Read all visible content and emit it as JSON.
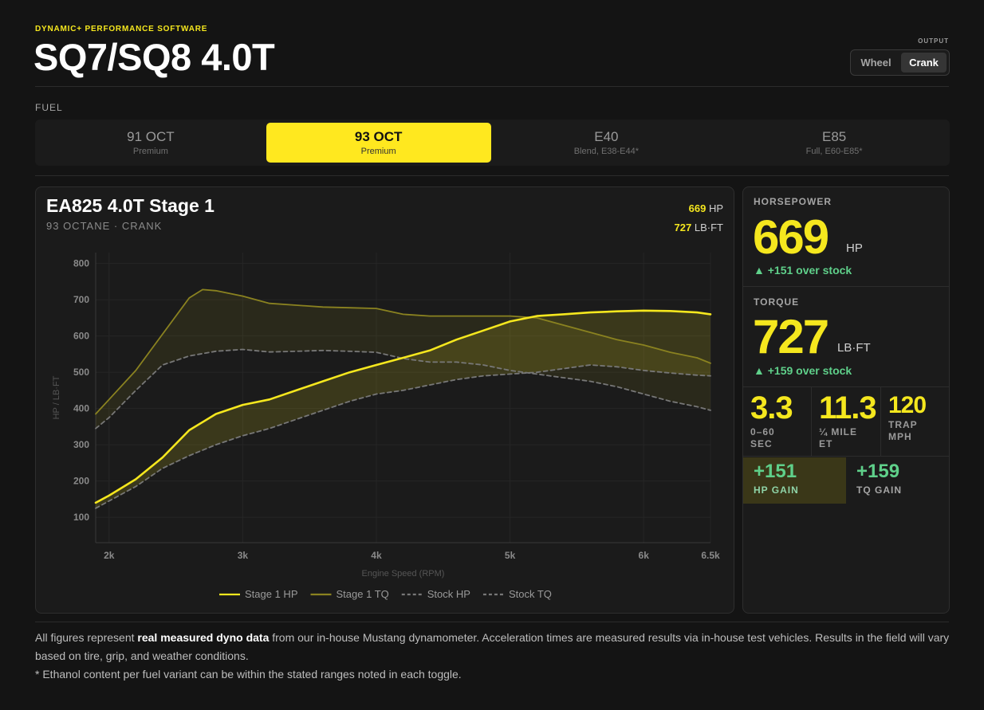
{
  "header": {
    "eyebrow": "DYNAMIC+ PERFORMANCE SOFTWARE",
    "title": "SQ7/SQ8 4.0T",
    "output_label": "OUTPUT",
    "output_options": [
      "Wheel",
      "Crank"
    ],
    "output_selected": "Crank"
  },
  "fuel": {
    "label": "FUEL",
    "options": [
      {
        "name": "91 OCT",
        "sub": "Premium"
      },
      {
        "name": "93 OCT",
        "sub": "Premium"
      },
      {
        "name": "E40",
        "sub": "Blend, E38-E44*"
      },
      {
        "name": "E85",
        "sub": "Full, E60-E85*"
      }
    ],
    "selected": "93 OCT"
  },
  "chart": {
    "title": "EA825 4.0T Stage 1",
    "subtitle": "93 OCTANE · CRANK",
    "readout_hp_value": "669",
    "readout_hp_unit": "HP",
    "readout_tq_value": "727",
    "readout_tq_unit": "LB·FT"
  },
  "colors": {
    "accent": "#f5e71e",
    "stage_tq": "#8a8220",
    "stock": "#777777",
    "gain": "#5fd08a"
  },
  "chart_data": {
    "type": "line",
    "xlabel": "Engine Speed (RPM)",
    "ylabel": "HP / LB·FT",
    "xlim": [
      1900,
      6500
    ],
    "ylim": [
      30,
      830
    ],
    "x_ticks": [
      2000,
      3000,
      4000,
      5000,
      6000,
      6500
    ],
    "x_tick_labels": [
      "2k",
      "3k",
      "4k",
      "5k",
      "6k",
      "6.5k"
    ],
    "y_ticks": [
      100,
      200,
      300,
      400,
      500,
      600,
      700,
      800
    ],
    "y_tick_labels": [
      "100",
      "200",
      "300",
      "400",
      "500",
      "600",
      "700",
      "800"
    ],
    "legend_position": "bottom",
    "series": [
      {
        "name": "Stage 1 HP",
        "style": "solid",
        "color": "#f5e71e",
        "x": [
          1900,
          2000,
          2200,
          2400,
          2600,
          2800,
          3000,
          3200,
          3400,
          3600,
          3800,
          4000,
          4200,
          4400,
          4600,
          4800,
          5000,
          5200,
          5400,
          5600,
          5800,
          6000,
          6200,
          6400,
          6500
        ],
        "y": [
          140,
          160,
          205,
          265,
          340,
          385,
          410,
          425,
          450,
          475,
          500,
          520,
          540,
          560,
          590,
          615,
          640,
          655,
          660,
          665,
          668,
          670,
          669,
          665,
          660
        ]
      },
      {
        "name": "Stage 1 TQ",
        "style": "solid",
        "color": "#8a8220",
        "x": [
          1900,
          2000,
          2200,
          2400,
          2600,
          2700,
          2800,
          3000,
          3200,
          3400,
          3600,
          3800,
          4000,
          4200,
          4400,
          4600,
          4800,
          5000,
          5200,
          5400,
          5600,
          5800,
          6000,
          6200,
          6400,
          6500
        ],
        "y": [
          385,
          425,
          505,
          605,
          705,
          728,
          725,
          710,
          690,
          685,
          680,
          678,
          676,
          660,
          655,
          655,
          655,
          655,
          650,
          630,
          610,
          590,
          575,
          555,
          540,
          525
        ]
      },
      {
        "name": "Stock HP",
        "style": "dashed",
        "color": "#777777",
        "x": [
          1900,
          2000,
          2200,
          2400,
          2600,
          2800,
          3000,
          3200,
          3400,
          3600,
          3800,
          4000,
          4200,
          4400,
          4600,
          4800,
          5000,
          5200,
          5400,
          5600,
          5800,
          6000,
          6200,
          6400,
          6500
        ],
        "y": [
          125,
          145,
          185,
          235,
          270,
          300,
          325,
          345,
          370,
          395,
          420,
          440,
          450,
          465,
          480,
          490,
          495,
          500,
          510,
          520,
          515,
          505,
          498,
          492,
          490
        ]
      },
      {
        "name": "Stock TQ",
        "style": "dashed",
        "color": "#777777",
        "x": [
          1900,
          2000,
          2200,
          2400,
          2600,
          2800,
          3000,
          3200,
          3400,
          3600,
          3800,
          4000,
          4200,
          4400,
          4600,
          4800,
          5000,
          5200,
          5400,
          5600,
          5800,
          6000,
          6200,
          6400,
          6500
        ],
        "y": [
          345,
          375,
          450,
          520,
          545,
          558,
          563,
          556,
          558,
          560,
          558,
          555,
          538,
          528,
          528,
          520,
          505,
          495,
          485,
          475,
          460,
          440,
          420,
          405,
          395
        ]
      }
    ]
  },
  "stats": {
    "hp": {
      "label": "HORSEPOWER",
      "value": "669",
      "unit": "HP",
      "delta": "▲ +151 over stock"
    },
    "tq": {
      "label": "TORQUE",
      "value": "727",
      "unit": "LB·FT",
      "delta": "▲ +159 over stock"
    },
    "zero_sixty": {
      "value": "3.3",
      "label": "0–60\nSEC"
    },
    "quarter_mile": {
      "value": "11.3",
      "label": "¼ MILE\nET"
    },
    "trap": {
      "value": "120",
      "label": "TRAP\nMPH"
    },
    "hp_gain": {
      "value": "+151",
      "label": "HP GAIN"
    },
    "tq_gain": {
      "value": "+159",
      "label": "TQ GAIN"
    }
  },
  "footnote": {
    "pre": "All figures represent ",
    "bold": "real measured dyno data",
    "post": " from our in-house Mustang dynamometer. Acceleration times are measured results via in-house test vehicles. Results in the field will vary based on tire, grip, and weather conditions.",
    "ethanol": "* Ethanol content per fuel variant can be within the stated ranges noted in each toggle."
  }
}
